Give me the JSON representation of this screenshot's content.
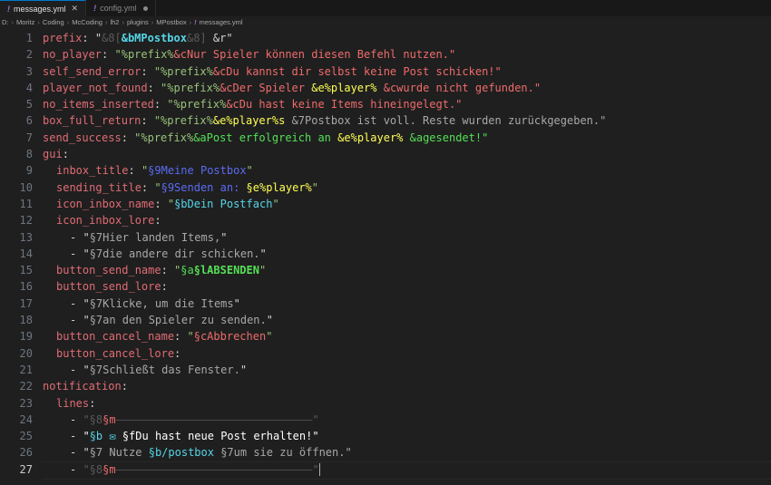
{
  "tabs": [
    {
      "icon": "!",
      "label": "messages.yml",
      "active": true
    },
    {
      "icon": "!",
      "label": "config.yml",
      "active": false
    }
  ],
  "breadcrumb": [
    "D:",
    "Moritz",
    "Coding",
    "McCoding",
    "lh2",
    "plugins",
    "MPostbox",
    "messages.yml"
  ],
  "lines": [
    {
      "n": "1",
      "segs": [
        [
          "k",
          "prefix"
        ],
        [
          "p",
          ": "
        ],
        [
          "s-wh",
          "\""
        ],
        [
          "c8",
          "&8["
        ],
        [
          "cb bold",
          "&bMPostbox"
        ],
        [
          "c8",
          "&8]"
        ],
        [
          "s-wh",
          " &r\""
        ]
      ]
    },
    {
      "n": "2",
      "segs": [
        [
          "k",
          "no_player"
        ],
        [
          "p",
          ": "
        ],
        [
          "s",
          "\""
        ],
        [
          "s",
          "%prefix%"
        ],
        [
          "cc",
          "&cNur Spieler können diesen Befehl nutzen.\""
        ]
      ]
    },
    {
      "n": "3",
      "segs": [
        [
          "k",
          "self_send_error"
        ],
        [
          "p",
          ": "
        ],
        [
          "s",
          "\"%prefix%"
        ],
        [
          "cc",
          "&cDu kannst dir selbst keine Post schicken!\""
        ]
      ]
    },
    {
      "n": "4",
      "segs": [
        [
          "k",
          "player_not_found"
        ],
        [
          "p",
          ": "
        ],
        [
          "s",
          "\"%prefix%"
        ],
        [
          "cc",
          "&cDer Spieler "
        ],
        [
          "ce",
          "&e%player% "
        ],
        [
          "cc",
          "&cwurde nicht gefunden.\""
        ]
      ]
    },
    {
      "n": "5",
      "segs": [
        [
          "k",
          "no_items_inserted"
        ],
        [
          "p",
          ": "
        ],
        [
          "s",
          "\"%prefix%"
        ],
        [
          "cc",
          "&cDu hast keine Items hineingelegt.\""
        ]
      ]
    },
    {
      "n": "6",
      "segs": [
        [
          "k",
          "box_full_return"
        ],
        [
          "p",
          ": "
        ],
        [
          "s",
          "\"%prefix%"
        ],
        [
          "ce",
          "&e%player%s "
        ],
        [
          "c7",
          "&7Postbox ist voll. Reste wurden zurückgegeben.\""
        ]
      ]
    },
    {
      "n": "7",
      "segs": [
        [
          "k",
          "send_success"
        ],
        [
          "p",
          ": "
        ],
        [
          "s",
          "\"%prefix%"
        ],
        [
          "ca",
          "&aPost erfolgreich an "
        ],
        [
          "ce",
          "&e%player% "
        ],
        [
          "ca",
          "&agesendet!\""
        ]
      ]
    },
    {
      "n": "8",
      "segs": [
        [
          "k",
          "gui"
        ],
        [
          "p",
          ":"
        ]
      ]
    },
    {
      "n": "9",
      "ind": 1,
      "segs": [
        [
          "k",
          "inbox_title"
        ],
        [
          "p",
          ": "
        ],
        [
          "s",
          "\""
        ],
        [
          "c9",
          "§9Meine Postbox"
        ],
        [
          "s",
          "\""
        ]
      ]
    },
    {
      "n": "10",
      "ind": 1,
      "segs": [
        [
          "k",
          "sending_title"
        ],
        [
          "p",
          ": "
        ],
        [
          "s",
          "\""
        ],
        [
          "c9",
          "§9Senden an: "
        ],
        [
          "ce",
          "§e%player%"
        ],
        [
          "s",
          "\""
        ]
      ]
    },
    {
      "n": "11",
      "ind": 1,
      "segs": [
        [
          "k",
          "icon_inbox_name"
        ],
        [
          "p",
          ": "
        ],
        [
          "s",
          "\""
        ],
        [
          "cb",
          "§bDein Postfach"
        ],
        [
          "s",
          "\""
        ]
      ]
    },
    {
      "n": "12",
      "ind": 1,
      "segs": [
        [
          "k",
          "icon_inbox_lore"
        ],
        [
          "p",
          ":"
        ]
      ]
    },
    {
      "n": "13",
      "ind": 2,
      "segs": [
        [
          "p",
          "- "
        ],
        [
          "s-wh",
          "\""
        ],
        [
          "c7",
          "§7Hier landen Items,"
        ],
        [
          "s-wh",
          "\""
        ]
      ]
    },
    {
      "n": "14",
      "ind": 2,
      "segs": [
        [
          "p",
          "- "
        ],
        [
          "s-wh",
          "\""
        ],
        [
          "c7",
          "§7die andere dir schicken."
        ],
        [
          "s-wh",
          "\""
        ]
      ]
    },
    {
      "n": "15",
      "ind": 1,
      "segs": [
        [
          "k",
          "button_send_name"
        ],
        [
          "p",
          ": "
        ],
        [
          "s",
          "\""
        ],
        [
          "ca",
          "§a"
        ],
        [
          "ca bold",
          "§lABSENDEN"
        ],
        [
          "s",
          "\""
        ]
      ]
    },
    {
      "n": "16",
      "ind": 1,
      "segs": [
        [
          "k",
          "button_send_lore"
        ],
        [
          "p",
          ":"
        ]
      ]
    },
    {
      "n": "17",
      "ind": 2,
      "segs": [
        [
          "p",
          "- "
        ],
        [
          "s-wh",
          "\""
        ],
        [
          "c7",
          "§7Klicke, um die Items"
        ],
        [
          "s-wh",
          "\""
        ]
      ]
    },
    {
      "n": "18",
      "ind": 2,
      "segs": [
        [
          "p",
          "- "
        ],
        [
          "s-wh",
          "\""
        ],
        [
          "c7",
          "§7an den Spieler zu senden."
        ],
        [
          "s-wh",
          "\""
        ]
      ]
    },
    {
      "n": "19",
      "ind": 1,
      "segs": [
        [
          "k",
          "button_cancel_name"
        ],
        [
          "p",
          ": "
        ],
        [
          "s",
          "\""
        ],
        [
          "cc",
          "§cAbbrechen"
        ],
        [
          "s",
          "\""
        ]
      ]
    },
    {
      "n": "20",
      "ind": 1,
      "segs": [
        [
          "k",
          "button_cancel_lore"
        ],
        [
          "p",
          ":"
        ]
      ]
    },
    {
      "n": "21",
      "ind": 2,
      "segs": [
        [
          "p",
          "- "
        ],
        [
          "s-wh",
          "\""
        ],
        [
          "c7",
          "§7Schließt das Fenster."
        ],
        [
          "s-wh",
          "\""
        ]
      ]
    },
    {
      "n": "22",
      "segs": [
        [
          "k",
          "notification"
        ],
        [
          "p",
          ":"
        ]
      ]
    },
    {
      "n": "23",
      "ind": 1,
      "segs": [
        [
          "k",
          "lines"
        ],
        [
          "p",
          ":"
        ]
      ]
    },
    {
      "n": "24",
      "ind": 2,
      "segs": [
        [
          "p",
          "- "
        ],
        [
          "c8",
          "\"§8"
        ],
        [
          "cc",
          "§m"
        ],
        [
          "c0 strike",
          "                              "
        ],
        [
          "c8",
          "\""
        ]
      ]
    },
    {
      "n": "25",
      "ind": 2,
      "segs": [
        [
          "p",
          "- "
        ],
        [
          "cf",
          "\""
        ],
        [
          "cb",
          "§b "
        ],
        [
          "cb",
          "✉"
        ],
        [
          "cf",
          " §fDu hast neue Post erhalten!\""
        ]
      ]
    },
    {
      "n": "26",
      "ind": 2,
      "segs": [
        [
          "p",
          "- "
        ],
        [
          "s-wh",
          "\""
        ],
        [
          "c7",
          "§7 Nutze "
        ],
        [
          "cb",
          "§b/postbox "
        ],
        [
          "c7",
          "§7um sie zu öffnen.\""
        ]
      ]
    },
    {
      "n": "27",
      "ind": 2,
      "current": true,
      "segs": [
        [
          "p",
          "- "
        ],
        [
          "c8",
          "\"§8"
        ],
        [
          "cc",
          "§m"
        ],
        [
          "c0 strike",
          "                              "
        ],
        [
          "c8",
          "\""
        ]
      ]
    }
  ]
}
